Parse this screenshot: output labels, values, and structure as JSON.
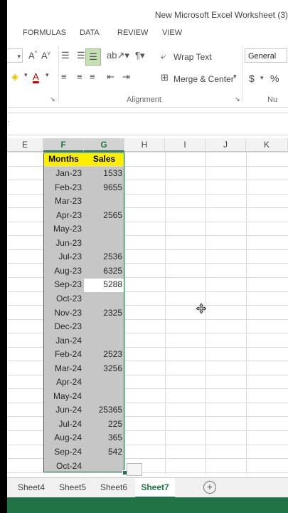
{
  "window": {
    "title": "New Microsoft Excel Worksheet (3)"
  },
  "ribbon_tabs": [
    "FORMULAS",
    "DATA",
    "REVIEW",
    "VIEW"
  ],
  "ribbon": {
    "wrap_text": "Wrap Text",
    "merge_center": "Merge & Center",
    "number_format": "General",
    "alignment_group": "Alignment",
    "number_group_partial": "Nu",
    "currency_symbol": "$",
    "percent_symbol": "%"
  },
  "columns": [
    "E",
    "F",
    "G",
    "H",
    "I",
    "J",
    "K"
  ],
  "table": {
    "headers": [
      "Months",
      "Sales"
    ],
    "rows": [
      [
        "Jan-23",
        "1533"
      ],
      [
        "Feb-23",
        "9655"
      ],
      [
        "Mar-23",
        ""
      ],
      [
        "Apr-23",
        "2565"
      ],
      [
        "May-23",
        ""
      ],
      [
        "Jun-23",
        ""
      ],
      [
        "Jul-23",
        "2536"
      ],
      [
        "Aug-23",
        "6325"
      ],
      [
        "Sep-23",
        "5288"
      ],
      [
        "Oct-23",
        ""
      ],
      [
        "Nov-23",
        "2325"
      ],
      [
        "Dec-23",
        ""
      ],
      [
        "Jan-24",
        ""
      ],
      [
        "Feb-24",
        "2523"
      ],
      [
        "Mar-24",
        "3256"
      ],
      [
        "Apr-24",
        ""
      ],
      [
        "May-24",
        ""
      ],
      [
        "Jun-24",
        "25365"
      ],
      [
        "Jul-24",
        "225"
      ],
      [
        "Aug-24",
        "365"
      ],
      [
        "Sep-24",
        "542"
      ],
      [
        "Oct-24",
        ""
      ]
    ]
  },
  "sheets": [
    "Sheet4",
    "Sheet5",
    "Sheet6",
    "Sheet7"
  ],
  "active_sheet": "Sheet7",
  "colors": {
    "excel_green": "#217346",
    "header_fill": "#ffee00",
    "selection_fill": "#c6c6c6"
  }
}
